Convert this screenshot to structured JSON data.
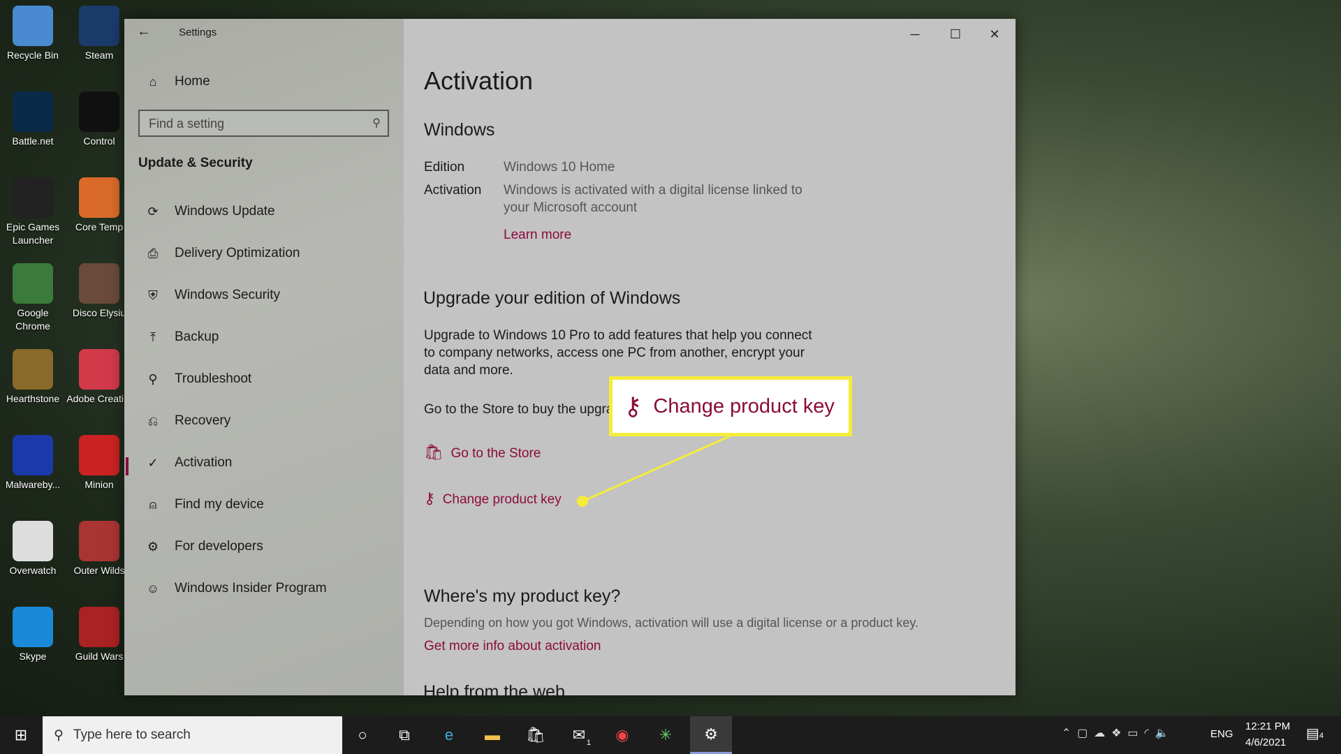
{
  "desktop": {
    "icons": [
      "Recycle Bin",
      "Steam",
      "Battle.net",
      "Control",
      "Epic Games Launcher",
      "Core Temp",
      "Google Chrome",
      "Disco Elysiu",
      "Hearthstone",
      "Adobe Creati...",
      "Malwareby...",
      "Minion",
      "Overwatch",
      "Outer Wilds",
      "Skype",
      "Guild Wars"
    ]
  },
  "window": {
    "title": "Settings",
    "back": "←",
    "minimize": "─",
    "maximize": "☐",
    "close": "✕"
  },
  "sidebar": {
    "home": "Home",
    "search_placeholder": "Find a setting",
    "section": "Update & Security",
    "items": [
      {
        "label": "Windows Update",
        "icon": "⟳"
      },
      {
        "label": "Delivery Optimization",
        "icon": "⎙"
      },
      {
        "label": "Windows Security",
        "icon": "⛨"
      },
      {
        "label": "Backup",
        "icon": "⤒"
      },
      {
        "label": "Troubleshoot",
        "icon": "⚲"
      },
      {
        "label": "Recovery",
        "icon": "⎌"
      },
      {
        "label": "Activation",
        "icon": "✓"
      },
      {
        "label": "Find my device",
        "icon": "⍝"
      },
      {
        "label": "For developers",
        "icon": "⚙"
      },
      {
        "label": "Windows Insider Program",
        "icon": "☺"
      }
    ],
    "active": "Activation",
    "accent": "#8a0c3c"
  },
  "main": {
    "title": "Activation",
    "windows_heading": "Windows",
    "edition_label": "Edition",
    "edition_value": "Windows 10 Home",
    "activation_label": "Activation",
    "activation_value_1": "Windows is activated with a digital license linked to",
    "activation_value_2": "your Microsoft account",
    "learn_more": "Learn more",
    "upgrade_heading": "Upgrade your edition of Windows",
    "upgrade_p1": "Upgrade to Windows 10 Pro to add features that help you connect",
    "upgrade_p2": "to company networks, access one PC from another, encrypt your",
    "upgrade_p3": "data and more.",
    "store_text": "Go to the Store to buy the upgra",
    "go_store": "Go to the Store",
    "change_key": "Change product key",
    "where_heading": "Where's my product key?",
    "where_text": "Depending on how you got Windows, activation will use a digital license or a product key.",
    "more_info": "Get more info about activation",
    "help_heading": "Help from the web"
  },
  "callout": {
    "label": "Change product key",
    "color": "#f5ec3a"
  },
  "taskbar": {
    "search_placeholder": "Type here to search",
    "lang": "ENG",
    "time": "12:21 PM",
    "date": "4/6/2021",
    "notifications": "4",
    "mail_badge": "1"
  }
}
